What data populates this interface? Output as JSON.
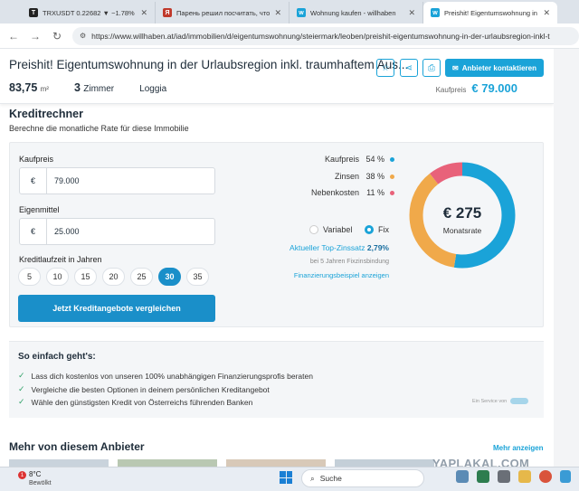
{
  "browser": {
    "tabs": [
      {
        "label": "TRXUSDT 0.22682 ▼ −1.78% Bi",
        "icon": "tradingview-icon",
        "color": "#222222"
      },
      {
        "label": "Парень решил посчитать, что",
        "icon": "yaplakal-icon",
        "color": "#c0392b"
      },
      {
        "label": "Wohnung kaufen - willhaben",
        "icon": "willhaben-icon",
        "color": "#1aa3d8"
      },
      {
        "label": "Preishit! Eigentumswohnung in",
        "icon": "willhaben-icon",
        "color": "#1aa3d8"
      }
    ],
    "url": "https://www.willhaben.at/iad/immobilien/d/eigentumswohnung/steiermark/leoben/preishit-eigentumswohnung-in-der-urlaubsregion-inkl-t"
  },
  "listing": {
    "title": "Preishit! Eigentumswohnung in der Urlaubsregion inkl. traumhaftem Aus...",
    "area": "83,75",
    "area_unit": "m²",
    "rooms": "3",
    "rooms_label": "Zimmer",
    "feature": "Loggia",
    "contact_label": "Anbieter kontaktieren",
    "price_label": "Kaufpreis",
    "price": "€ 79.000"
  },
  "calculator": {
    "title": "Kreditrechner",
    "subtitle": "Berechne die monatliche Rate für diese Immobilie",
    "kaufpreis_label": "Kaufpreis",
    "kaufpreis_currency": "€",
    "kaufpreis_value": "79.000",
    "eigenmittel_label": "Eigenmittel",
    "eigenmittel_currency": "€",
    "eigenmittel_value": "25.000",
    "laufzeit_label": "Kreditlaufzeit in Jahren",
    "years": [
      "5",
      "10",
      "15",
      "20",
      "25",
      "30",
      "35"
    ],
    "selected_year": "30",
    "cta_label": "Jetzt Kreditangebote vergleichen",
    "legend": [
      {
        "label": "Kaufpreis",
        "pct": "54 %",
        "value": 54,
        "color": "#1aa3d8"
      },
      {
        "label": "Zinsen",
        "pct": "38 %",
        "value": 38,
        "color": "#f0a94a"
      },
      {
        "label": "Nebenkosten",
        "pct": "11 %",
        "value": 11,
        "color": "#e8627a"
      }
    ],
    "radio_variabel": "Variabel",
    "radio_fix": "Fix",
    "selected_rate_type": "Fix",
    "zins_label": "Aktueller Top-Zinssatz",
    "zins_value": "2,79%",
    "zins_sub": "bei 5 Jahren Fixzinsbindung",
    "beispiel_link": "Finanzierungsbeispiel anzeigen",
    "monthly_amount": "€ 275",
    "monthly_label": "Monatsrate"
  },
  "how": {
    "title": "So einfach geht's:",
    "items": [
      "Lass dich kostenlos von unseren 100% unabhängigen Finanzierungsprofis beraten",
      "Vergleiche die besten Optionen in deinem persönlichen Kreditangebot",
      "Wähle den günstigsten Kredit von Österreichs führenden Banken"
    ],
    "service_label": "Ein Service von"
  },
  "more": {
    "title": "Mehr von diesem Anbieter",
    "link": "Mehr anzeigen"
  },
  "taskbar": {
    "badge": "1",
    "temperature": "8°C",
    "weather": "Bewölkt",
    "search_placeholder": "Suche"
  },
  "watermark": "YAPLAKAL.COM"
}
